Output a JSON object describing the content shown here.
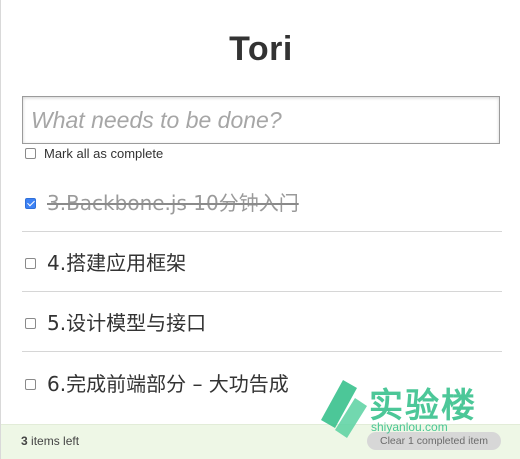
{
  "app": {
    "title": "Tori"
  },
  "new_todo": {
    "placeholder": "What needs to be done?",
    "value": ""
  },
  "toggle_all": {
    "label": "Mark all as complete",
    "checked": false
  },
  "todos": [
    {
      "text": "3.Backbone.js 10分钟入门",
      "completed": true
    },
    {
      "text": "4.搭建应用框架",
      "completed": false
    },
    {
      "text": "5.设计模型与接口",
      "completed": false
    },
    {
      "text": "6.完成前端部分 – 大功告成",
      "completed": false
    }
  ],
  "footer": {
    "count": "3",
    "count_suffix": " items left",
    "clear_label": "Clear 1 completed item"
  },
  "watermark": {
    "brand": "实验楼",
    "site": "shiyanlou.com"
  },
  "colors": {
    "checkbox_checked": "#3d82f5",
    "footer_bg": "#eef7e6",
    "watermark": "#34c08a"
  }
}
